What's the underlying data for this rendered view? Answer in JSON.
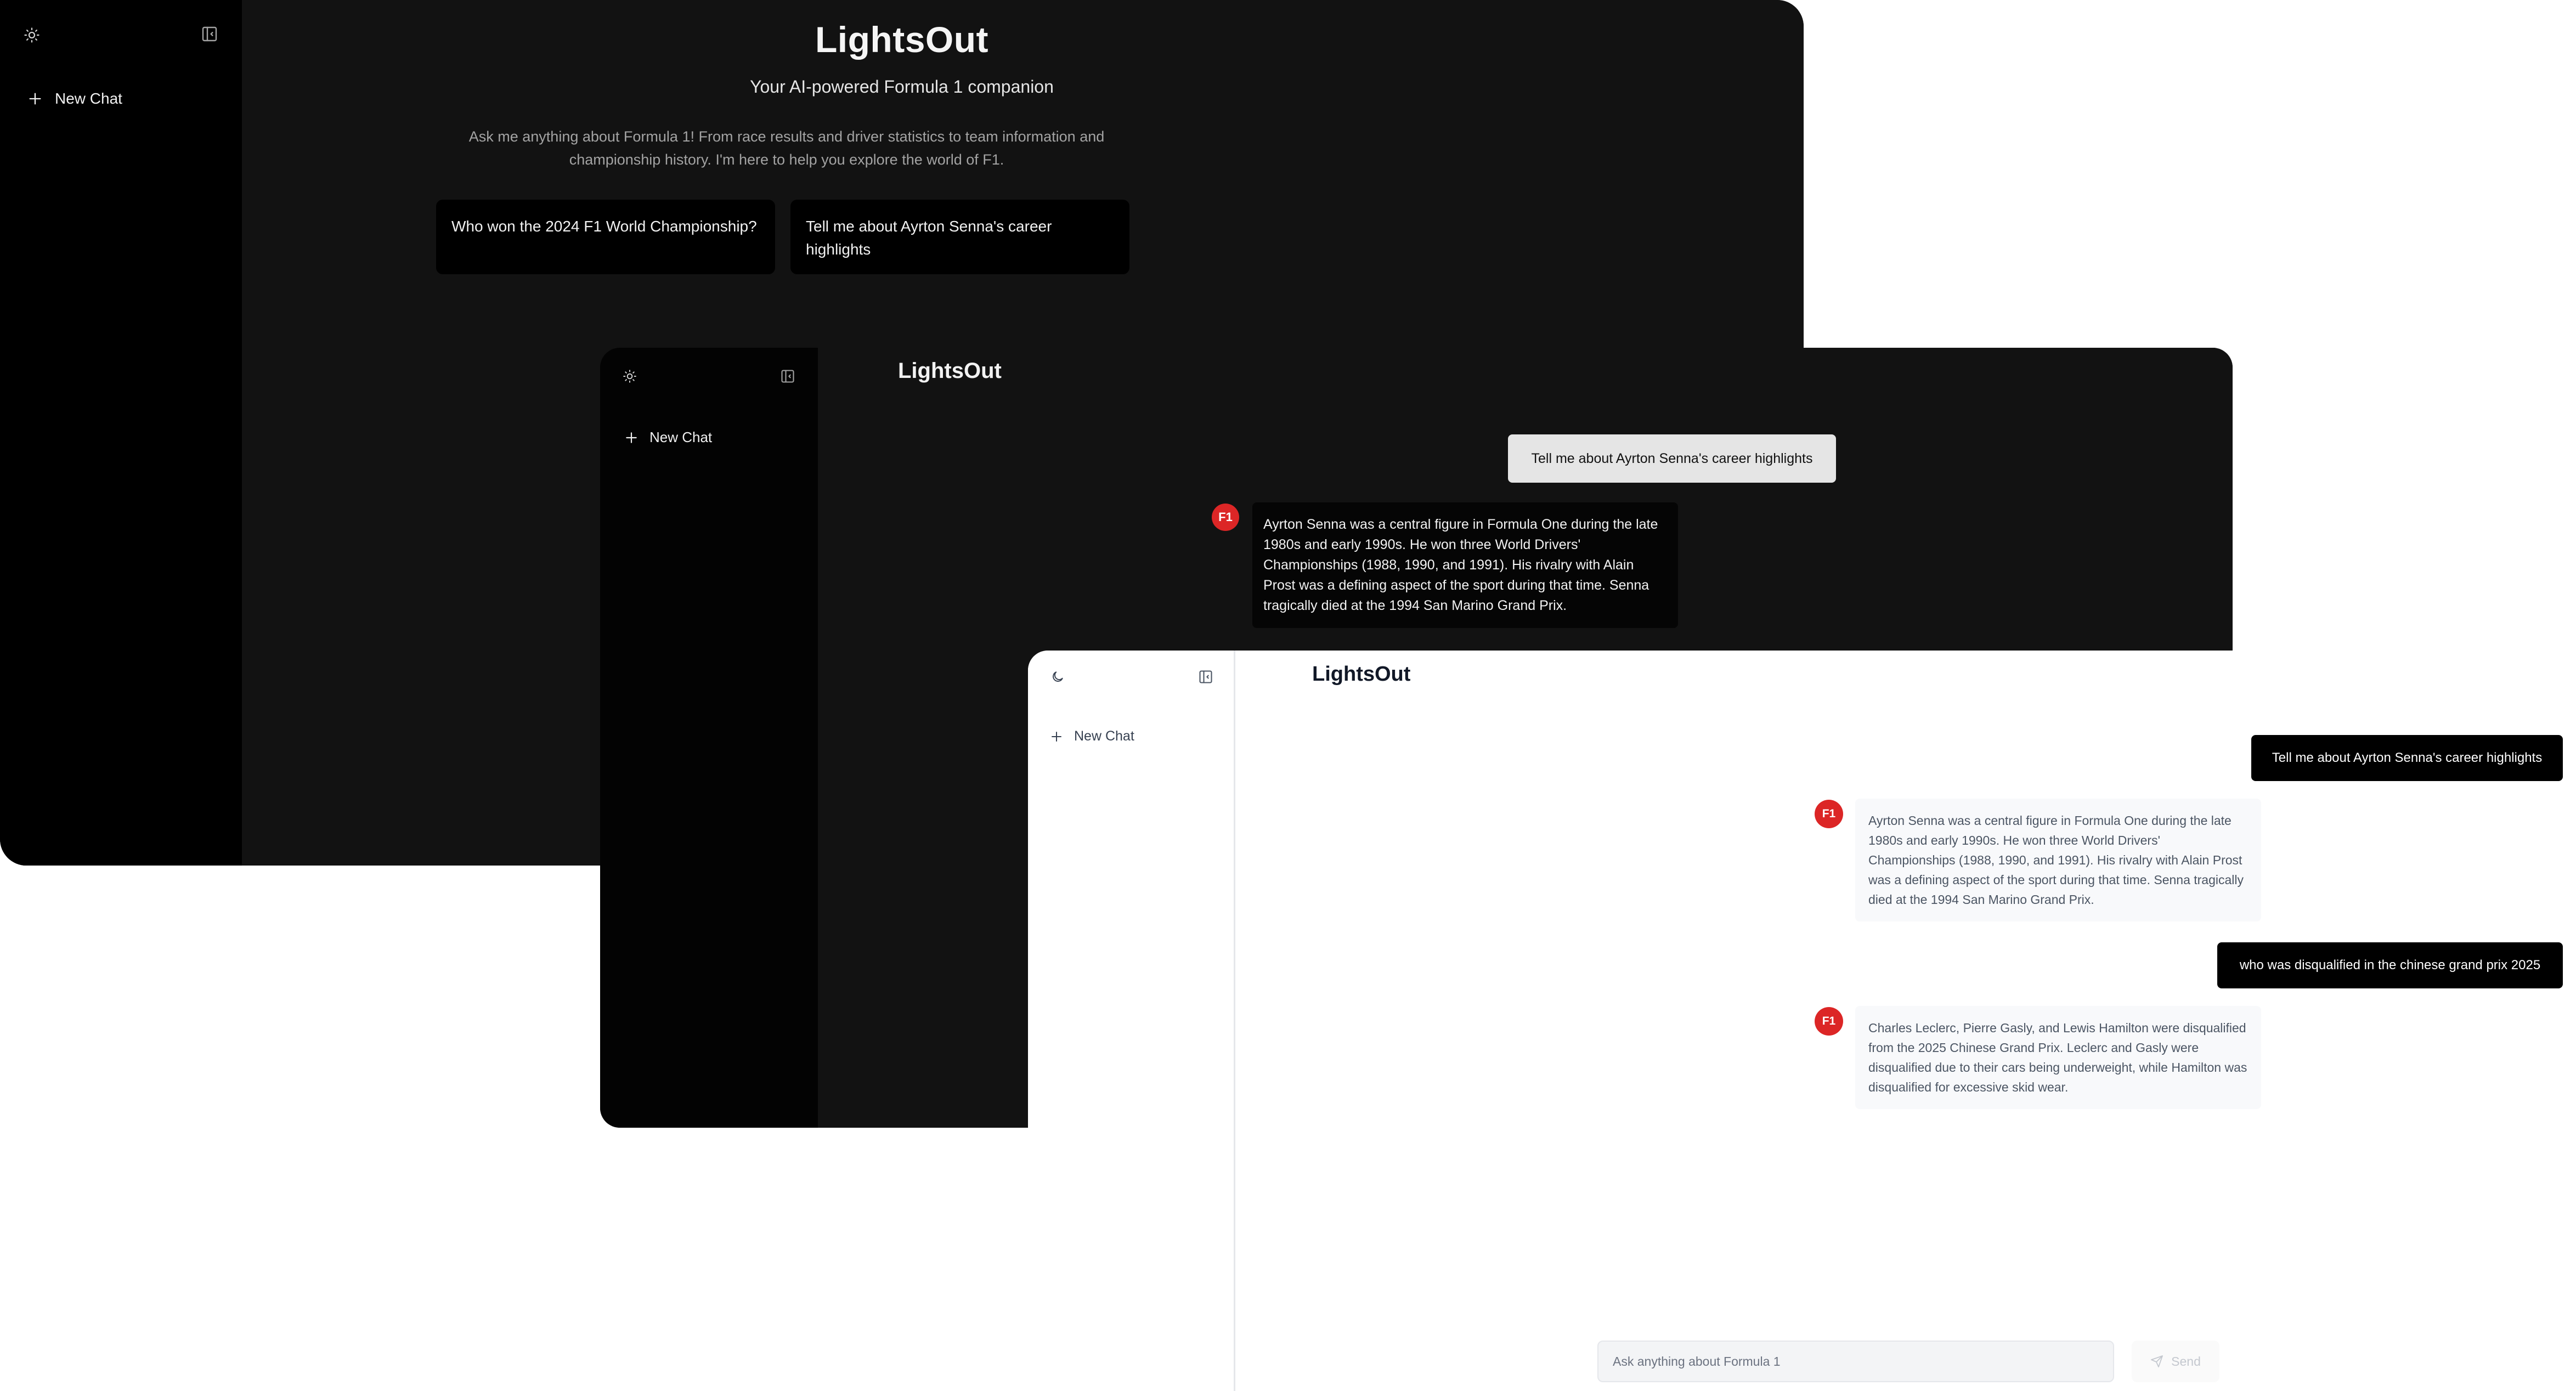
{
  "colors": {
    "dark_bg": "#121212",
    "dark_sidebar": "#000000",
    "accent_red": "#dc2626",
    "light_bg": "#ffffff",
    "light_bubble": "#f8f9fb"
  },
  "icons": {
    "theme_dark": "sun-icon",
    "theme_light": "moon-icon",
    "collapse": "sidebar-collapse-icon",
    "new_chat": "plus-icon",
    "send": "paper-plane-icon"
  },
  "welcome": {
    "sidebar": {
      "new_chat": "New Chat"
    },
    "title": "LightsOut",
    "subtitle": "Your AI-powered Formula 1 companion",
    "description": "Ask me anything about Formula 1! From race results and driver statistics to team information and championship history. I'm here to help you explore the world of F1.",
    "suggestions": [
      "Who won the 2024 F1 World Championship?",
      "Tell me about Ayrton Senna's career highlights"
    ]
  },
  "dark_chat": {
    "sidebar": {
      "new_chat": "New Chat"
    },
    "header": "LightsOut",
    "messages": [
      {
        "role": "user",
        "text": "Tell me about Ayrton Senna's career highlights"
      },
      {
        "role": "assistant",
        "avatar": "F1",
        "text": "Ayrton Senna was a central figure in Formula One during the late 1980s and early 1990s. He won three World Drivers' Championships (1988, 1990, and 1991). His rivalry with Alain Prost was a defining aspect of the sport during that time. Senna tragically died at the 1994 San Marino Grand Prix."
      }
    ]
  },
  "light_chat": {
    "sidebar": {
      "new_chat": "New Chat"
    },
    "header": "LightsOut",
    "messages": [
      {
        "role": "user",
        "text": "Tell me about Ayrton Senna's career highlights"
      },
      {
        "role": "assistant",
        "avatar": "F1",
        "text": "Ayrton Senna was a central figure in Formula One during the late 1980s and early 1990s. He won three World Drivers' Championships (1988, 1990, and 1991). His rivalry with Alain Prost was a defining aspect of the sport during that time. Senna tragically died at the 1994 San Marino Grand Prix."
      },
      {
        "role": "user",
        "text": "who was disqualified in the chinese grand prix 2025"
      },
      {
        "role": "assistant",
        "avatar": "F1",
        "text": "Charles Leclerc, Pierre Gasly, and Lewis Hamilton were disqualified from the 2025 Chinese Grand Prix. Leclerc and Gasly were disqualified due to their cars being underweight, while Hamilton was disqualified for excessive skid wear."
      }
    ],
    "input": {
      "placeholder": "Ask anything about Formula 1",
      "value": ""
    },
    "send_label": "Send"
  }
}
